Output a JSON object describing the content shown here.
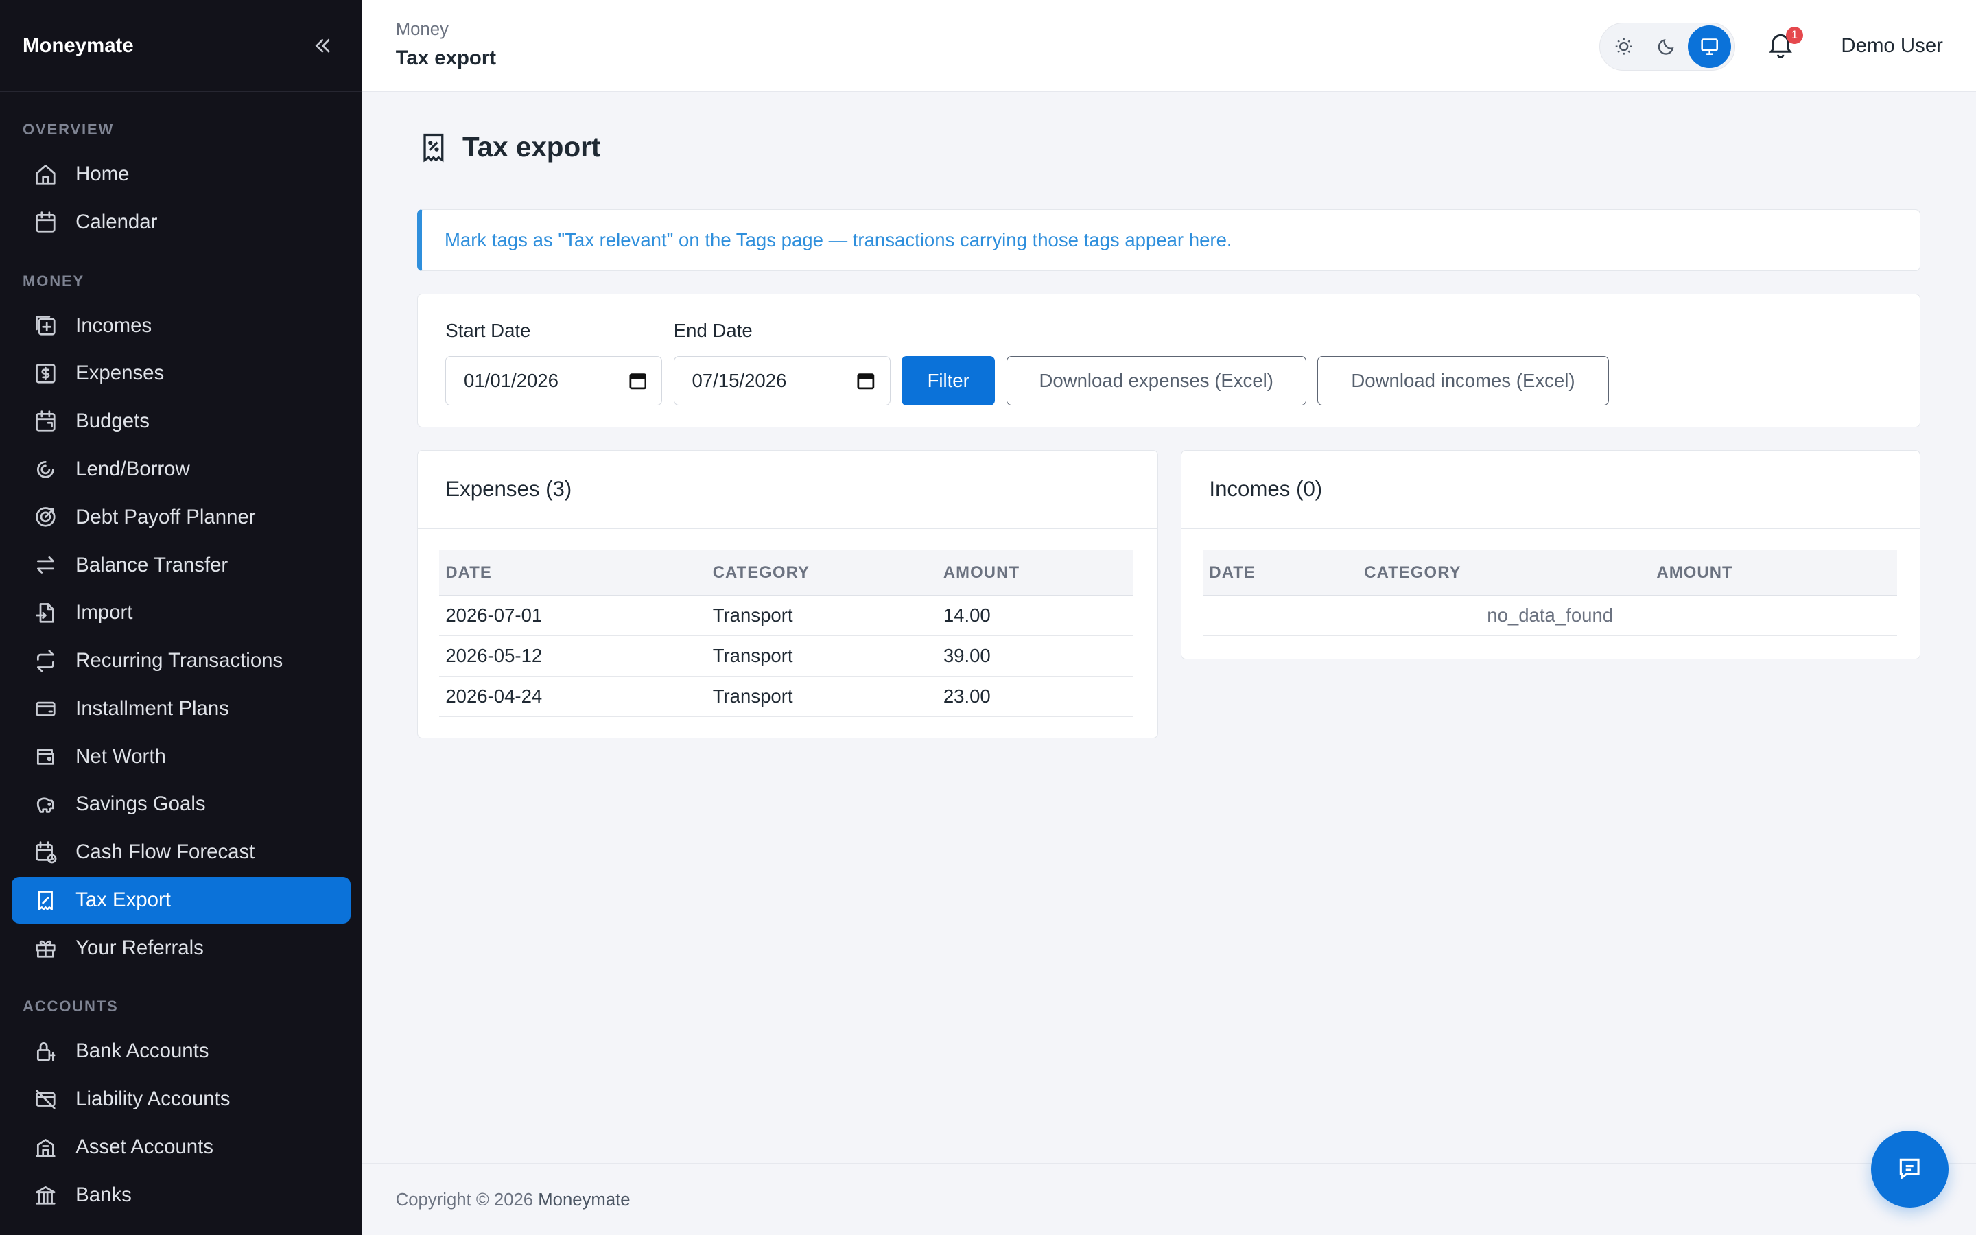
{
  "app": {
    "brand": "Moneymate"
  },
  "sidebar": {
    "sections": [
      {
        "label": "OVERVIEW",
        "items": [
          {
            "label": "Home",
            "icon": "home-icon"
          },
          {
            "label": "Calendar",
            "icon": "calendar-icon"
          }
        ]
      },
      {
        "label": "MONEY",
        "items": [
          {
            "label": "Incomes",
            "icon": "income-icon"
          },
          {
            "label": "Expenses",
            "icon": "expense-icon"
          },
          {
            "label": "Budgets",
            "icon": "budget-icon"
          },
          {
            "label": "Lend/Borrow",
            "icon": "lend-borrow-icon"
          },
          {
            "label": "Debt Payoff Planner",
            "icon": "target-icon"
          },
          {
            "label": "Balance Transfer",
            "icon": "transfer-icon"
          },
          {
            "label": "Import",
            "icon": "import-icon"
          },
          {
            "label": "Recurring Transactions",
            "icon": "repeat-icon"
          },
          {
            "label": "Installment Plans",
            "icon": "card-icon"
          },
          {
            "label": "Net Worth",
            "icon": "wallet-icon"
          },
          {
            "label": "Savings Goals",
            "icon": "piggy-bank-icon"
          },
          {
            "label": "Cash Flow Forecast",
            "icon": "forecast-icon"
          },
          {
            "label": "Tax Export",
            "icon": "receipt-tax-icon",
            "active": true
          },
          {
            "label": "Your Referrals",
            "icon": "gift-icon"
          }
        ]
      },
      {
        "label": "ACCOUNTS",
        "items": [
          {
            "label": "Bank Accounts",
            "icon": "bank-account-icon"
          },
          {
            "label": "Liability Accounts",
            "icon": "liability-icon"
          },
          {
            "label": "Asset Accounts",
            "icon": "asset-icon"
          },
          {
            "label": "Banks",
            "icon": "bank-icon"
          }
        ]
      }
    ]
  },
  "header": {
    "breadcrumb_parent": "Money",
    "breadcrumb_current": "Tax export",
    "notification_count": "1",
    "user_name": "Demo User"
  },
  "page": {
    "title": "Tax export",
    "info": "Mark tags as \"Tax relevant\" on the Tags page — transactions carrying those tags appear here."
  },
  "filter": {
    "start_label": "Start Date",
    "start_value": "01/01/2026",
    "end_label": "End Date",
    "end_value": "07/15/2026",
    "filter_button": "Filter",
    "download_expenses": "Download expenses (Excel)",
    "download_incomes": "Download incomes (Excel)"
  },
  "expenses": {
    "title": "Expenses (3)",
    "columns": [
      "DATE",
      "CATEGORY",
      "AMOUNT"
    ],
    "rows": [
      [
        "2026-07-01",
        "Transport",
        "14.00"
      ],
      [
        "2026-05-12",
        "Transport",
        "39.00"
      ],
      [
        "2026-04-24",
        "Transport",
        "23.00"
      ]
    ]
  },
  "incomes": {
    "title": "Incomes (0)",
    "columns": [
      "DATE",
      "CATEGORY",
      "AMOUNT"
    ],
    "empty": "no_data_found"
  },
  "footer": {
    "text": "Copyright © 2026",
    "brand": "Moneymate"
  },
  "colors": {
    "accent": "#0b72d9",
    "sidebar_bg": "#12121a",
    "info": "#2f8fdc",
    "badge": "#e5484d"
  }
}
